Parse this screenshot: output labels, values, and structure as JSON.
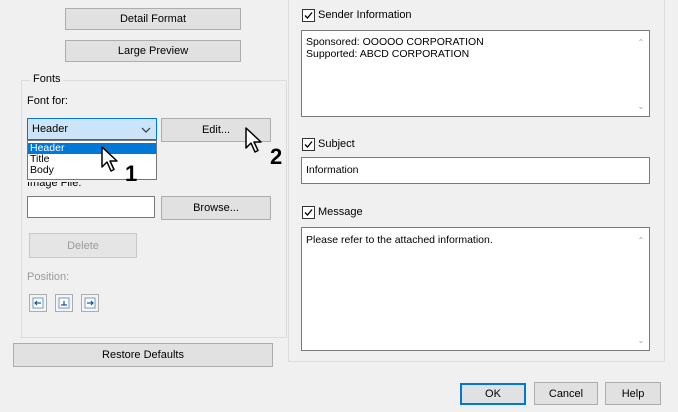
{
  "left_panel": {
    "detail_format_label": "Detail Format",
    "large_preview_label": "Large Preview",
    "fonts_group_title": "Fonts",
    "font_for_label": "Font for:",
    "font_for_value": "Header",
    "font_for_options": [
      "Header",
      "Title",
      "Body"
    ],
    "font_for_selected_index": 0,
    "edit_label": "Edit...",
    "image_file_label": "Image File:",
    "image_file_value": "",
    "browse_label": "Browse...",
    "delete_label": "Delete",
    "position_label": "Position:",
    "position_icons": [
      "align-left-icon",
      "align-center-icon",
      "align-right-icon"
    ],
    "restore_defaults_label": "Restore Defaults"
  },
  "right_panel": {
    "sender_information": {
      "label": "Sender Information",
      "checked": true,
      "lines": [
        "Sponsored: OOOOO CORPORATION",
        "Supported: ABCD CORPORATION"
      ]
    },
    "subject": {
      "label": "Subject",
      "checked": true,
      "value": "Information"
    },
    "message": {
      "label": "Message",
      "checked": true,
      "value": "Please refer to the attached information."
    }
  },
  "footer": {
    "ok_label": "OK",
    "cancel_label": "Cancel",
    "help_label": "Help"
  },
  "callouts": {
    "step1": "1",
    "step2": "2"
  },
  "colors": {
    "selection": "#0078d7",
    "dialog_bg": "#f0f0f0",
    "dropdown_bg": "#cce4f7"
  }
}
